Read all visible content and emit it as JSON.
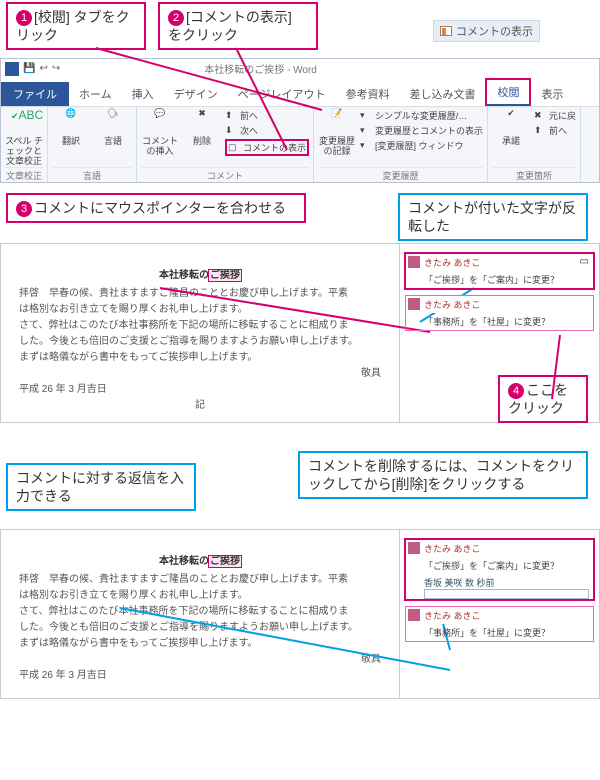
{
  "callouts": {
    "c1": {
      "num": "1",
      "text": "[校閲] タブをクリック"
    },
    "c2": {
      "num": "2",
      "text": "[コメントの表示] をクリック"
    },
    "c3": {
      "num": "3",
      "text": "コメントにマウスポインターを合わせる"
    },
    "c4": {
      "num": "4",
      "text": "ここをクリック"
    },
    "info1": "コメントが付いた文字が反転した",
    "info2": "コメントに対する返信を入力できる",
    "info3": "コメントを削除するには、コメントをクリックしてから[削除]をクリックする"
  },
  "btn": {
    "showComments": "コメントの表示"
  },
  "app": {
    "title": "本社移転のご挨拶 - Word"
  },
  "tabs": {
    "file": "ファイル",
    "home": "ホーム",
    "insert": "挿入",
    "design": "デザイン",
    "layout": "ページレイアウト",
    "ref": "参考資料",
    "mail": "差し込み文書",
    "review": "校閲",
    "view": "表示"
  },
  "ribbon": {
    "proof": {
      "label": "文章校正",
      "spell": "スペル チェックと文章校正"
    },
    "lang": {
      "label": "言語",
      "trans": "翻訳",
      "lang": "言語"
    },
    "comments": {
      "label": "コメント",
      "new": "コメントの挿入",
      "del": "削除",
      "prev": "前へ",
      "next": "次へ",
      "show": "コメントの表示"
    },
    "track": {
      "label": "変更履歴",
      "track": "変更履歴の記録",
      "simple": "シンプルな変更履歴/…",
      "showmk": "変更履歴とコメントの表示",
      "pane": "[変更履歴] ウィンドウ"
    },
    "changes": {
      "label": "変更箇所",
      "accept": "承諾",
      "restore": "元に戻",
      "prev": "前へ"
    }
  },
  "doc": {
    "title": "本社移転のご挨拶",
    "mark": "ご挨拶",
    "body1": "拝啓　早春の候、貴社ますますご隆昌のこととお慶び申し上げます。平素",
    "body2": "は格別なお引き立てを賜り厚くお礼申し上げます。",
    "body3": "さて、弊社はこのたび本社事務所を下記の場所に移転することに相成りま",
    "body4": "した。今後とも倍旧のご支援とご指導を賜りますようお願い申し上げます。",
    "body5": "まずは略儀ながら書中をもってご挨拶申し上げます。",
    "sign": "敬具",
    "date": "平成 26 年 3 月吉日",
    "sep": "記"
  },
  "cmt": {
    "author": "きたみ あきこ",
    "t1": "「ご挨拶」を「ご案内」に変更？",
    "t2": "「事務所」を「社屋」に変更？",
    "me": "香坂 美咲 数 秒前"
  }
}
